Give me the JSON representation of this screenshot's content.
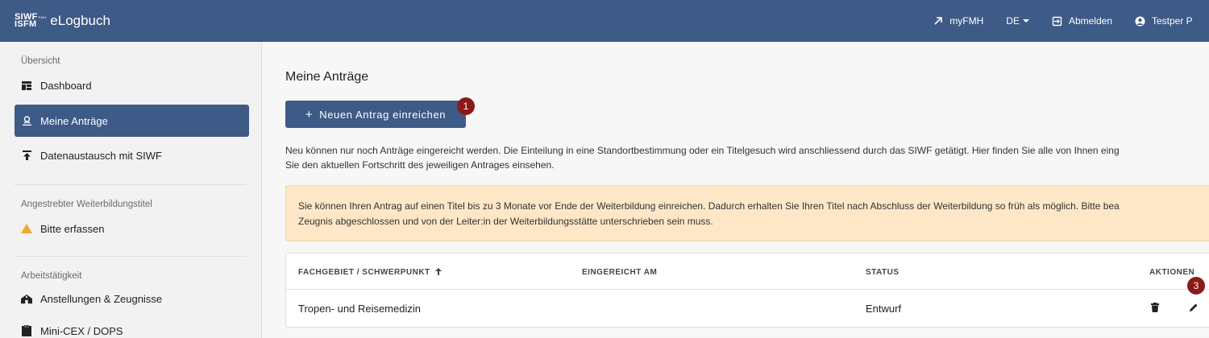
{
  "header": {
    "logo_line1": "SIWF",
    "logo_line1_small": "FMH",
    "logo_line2": "ISFM",
    "app_name": "eLogbuch",
    "nav": [
      {
        "label": "myFMH",
        "icon": "external-link-icon"
      },
      {
        "label": "DE",
        "icon": "chevron-down-icon"
      },
      {
        "label": "Abmelden",
        "icon": "logout-icon"
      },
      {
        "label": "Testper P",
        "icon": "user-circle-icon"
      }
    ]
  },
  "sidebar": {
    "sections": [
      {
        "label": "Übersicht"
      },
      {
        "label": "Angestrebter Weiterbildungstitel"
      },
      {
        "label": "Arbeitstätigkeit"
      }
    ],
    "items": [
      {
        "label": "Dashboard",
        "icon": "dashboard-icon"
      },
      {
        "label": "Meine Anträge",
        "icon": "signature-icon"
      },
      {
        "label": "Datenaustausch mit SIWF",
        "icon": "upload-icon"
      },
      {
        "label": "Bitte erfassen",
        "icon": "warning-icon"
      },
      {
        "label": "Anstellungen & Zeugnisse",
        "icon": "hospital-icon"
      },
      {
        "label": "Mini-CEX / DOPS",
        "icon": "clipboard-icon"
      }
    ]
  },
  "main": {
    "title": "Meine Anträge",
    "new_button": "Neuen Antrag einreichen",
    "intro_line1": "Neu können nur noch Anträge eingereicht werden. Die Einteilung in eine Standortbestimmung oder ein Titelgesuch wird anschliessend durch das SIWF getätigt. Hier finden Sie alle von Ihnen eing",
    "intro_line2": "Sie den aktuellen Fortschritt des jeweiligen Antrages einsehen.",
    "notice_line1": "Sie können Ihren Antrag auf einen Titel bis zu 3 Monate vor Ende der Weiterbildung einreichen. Dadurch erhalten Sie Ihren Titel nach Abschluss der Weiterbildung so früh als möglich. Bitte bea",
    "notice_line2": "Zeugnis abgeschlossen und von der Leiter:in der Weiterbildungsstätte unterschrieben sein muss.",
    "table": {
      "columns": [
        "FACHGEBIET / SCHWERPUNKT",
        "EINGEREICHT AM",
        "STATUS",
        "AKTIONEN"
      ],
      "sort_icon": "arrow-up-icon",
      "rows": [
        {
          "fachgebiet": "Tropen- und Reisemedizin",
          "eingereicht": "",
          "status": "Entwurf",
          "actions": [
            "trash-icon",
            "pencil-icon"
          ]
        }
      ]
    },
    "markers": [
      "1",
      "3"
    ]
  },
  "colors": {
    "primary": "#3e5a87",
    "notice_bg": "#fde7c6",
    "marker": "#8b1a1a",
    "warning": "#f0a830"
  }
}
